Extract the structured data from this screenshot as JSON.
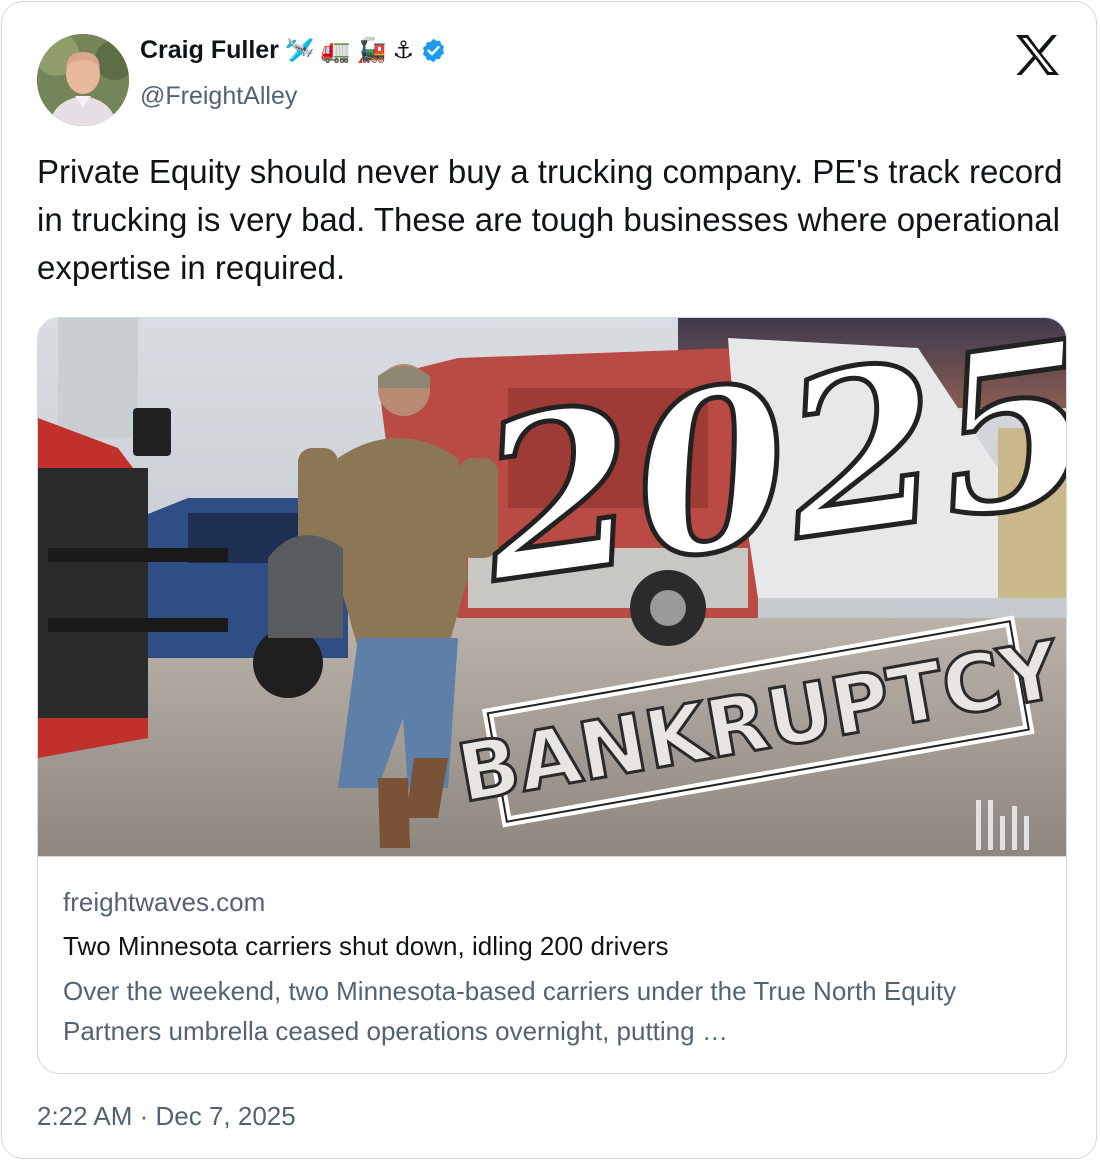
{
  "author": {
    "name": "Craig Fuller",
    "emoji": [
      "🛩️",
      "🚛",
      "🚂",
      "⚓"
    ],
    "handle": "@FreightAlley",
    "verified": true
  },
  "icons": {
    "platform": "x-logo-icon",
    "verified": "verified-badge-icon"
  },
  "tweet": {
    "text": "Private Equity should never buy a trucking company. PE's track record in trucking is very bad. These are tough businesses where operational expertise in required.",
    "timestamp": "2:22 AM · Dec 7, 2025"
  },
  "link_card": {
    "image_overlay": {
      "year": "2025",
      "stamp": "BANKRUPTCY"
    },
    "domain": "freightwaves.com",
    "title": "Two Minnesota carriers shut down, idling 200 drivers",
    "description": "Over the weekend, two Minnesota-based carriers under the True North Equity Partners umbrella ceased operations overnight, putting …"
  },
  "colors": {
    "verified_blue": "#1d9bf0",
    "text_primary": "#0f1419",
    "text_secondary": "#536471",
    "border": "#cfd9de"
  }
}
